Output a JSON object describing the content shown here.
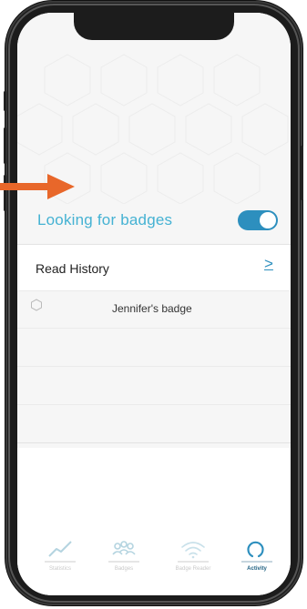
{
  "header": {
    "title": "Looking for badges",
    "toggle_on": true
  },
  "read_history": {
    "label": "Read History",
    "chevron": ">"
  },
  "badges": [
    {
      "name": "Jennifer's badge"
    }
  ],
  "tabs": [
    {
      "label": "Statistics",
      "icon": "chart-line-icon",
      "active": false
    },
    {
      "label": "Badges",
      "icon": "people-icon",
      "active": false
    },
    {
      "label": "Badge Reader",
      "icon": "wifi-icon",
      "active": false
    },
    {
      "label": "Activity",
      "icon": "activity-ring-icon",
      "active": true
    }
  ],
  "colors": {
    "accent": "#45b2d3",
    "toggle": "#2d8fbe",
    "arrow": "#e8672a",
    "active_tab": "#1d5f80"
  }
}
